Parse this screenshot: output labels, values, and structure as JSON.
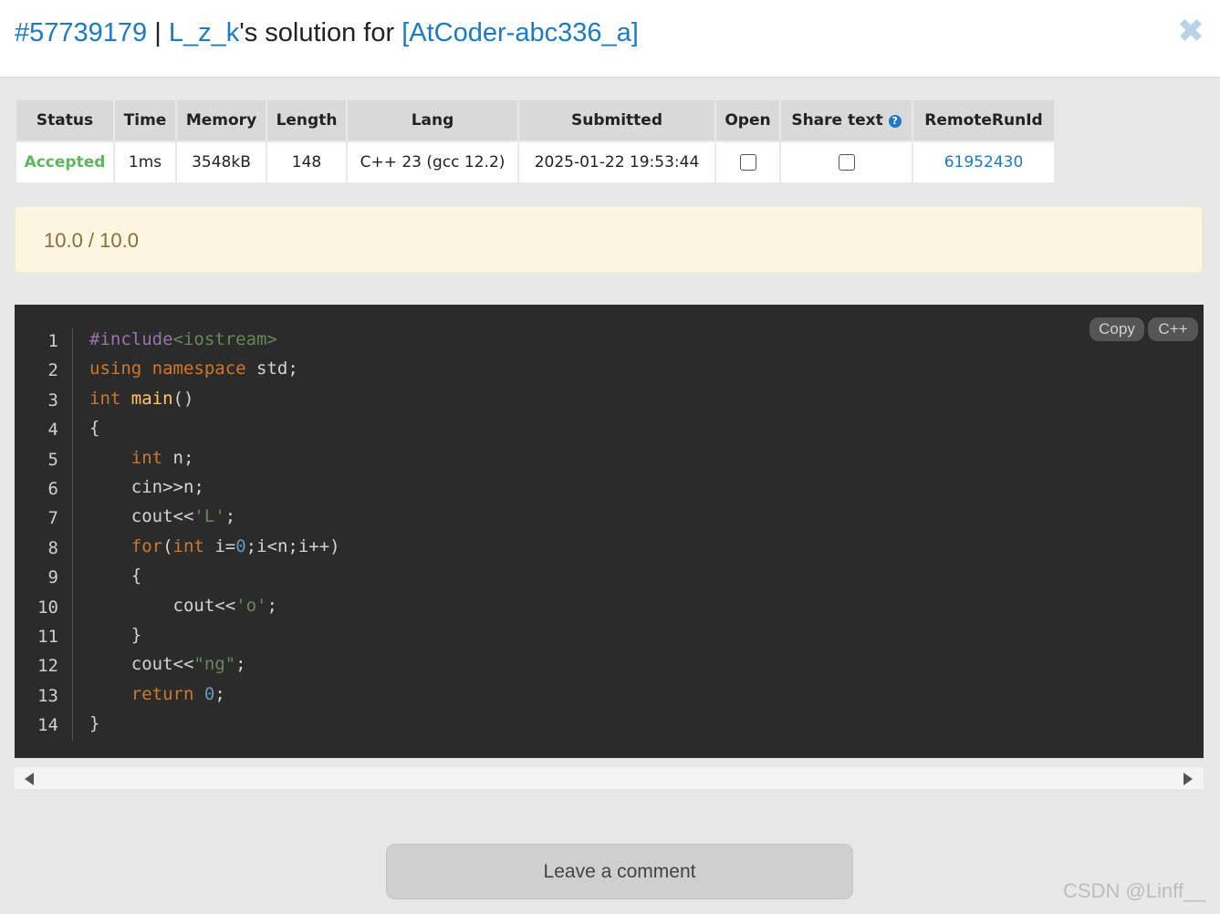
{
  "header": {
    "id_text": "#57739179",
    "separator": " | ",
    "user": "L_z_k",
    "middle_text": "'s solution for ",
    "problem": "[AtCoder-abc336_a]",
    "close_symbol": "✖"
  },
  "table": {
    "headers": [
      "Status",
      "Time",
      "Memory",
      "Length",
      "Lang",
      "Submitted",
      "Open",
      "Share text",
      "RemoteRunId"
    ],
    "row": {
      "status": "Accepted",
      "time": "1ms",
      "memory": "3548kB",
      "length": "148",
      "lang": "C++ 23 (gcc 12.2)",
      "submitted": "2025-01-22 19:53:44",
      "open_checked": false,
      "share_checked": false,
      "remote_run_id": "61952430"
    },
    "help_icon": "question-circle-icon"
  },
  "score": "10.0 / 10.0",
  "code": {
    "copy_label": "Copy",
    "lang_label": "C++",
    "line_numbers": [
      "1",
      "2",
      "3",
      "4",
      "5",
      "6",
      "7",
      "8",
      "9",
      "10",
      "11",
      "12",
      "13",
      "14"
    ],
    "lines": [
      "#include<iostream>",
      "using namespace std;",
      "int main()",
      "{",
      "    int n;",
      "    cin>>n;",
      "    cout<<'L';",
      "    for(int i=0;i<n;i++)",
      "    {",
      "        cout<<'o';",
      "    }",
      "    cout<<\"ng\";",
      "    return 0;",
      "}"
    ]
  },
  "comment_button": "Leave a comment",
  "watermark": "CSDN @Linff__",
  "colors": {
    "link": "#1a7bc7",
    "accepted": "#5cb85c",
    "score_bg": "#fcf6e1",
    "code_bg": "#2b2b2b"
  }
}
